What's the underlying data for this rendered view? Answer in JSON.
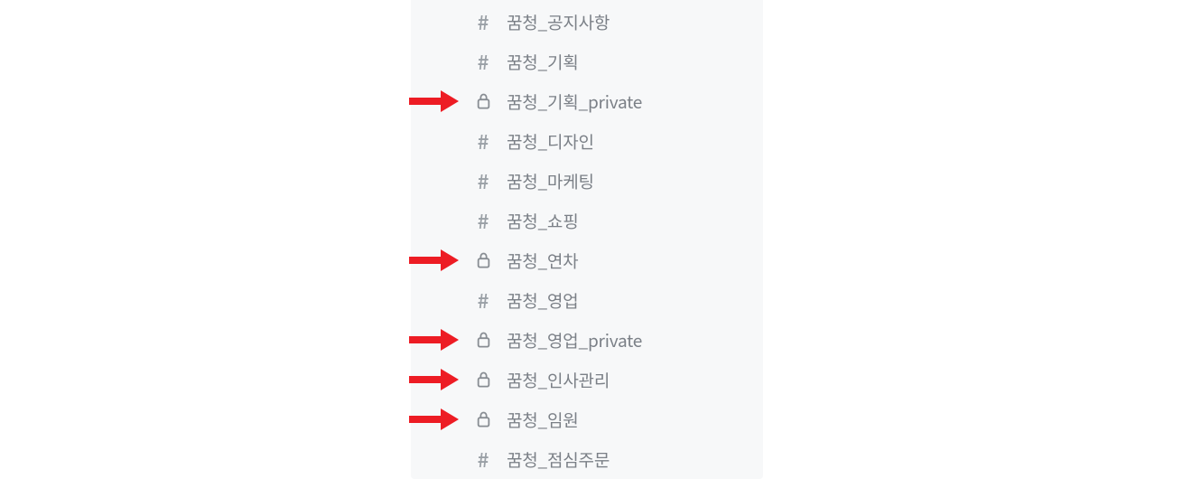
{
  "channels": [
    {
      "name": "꿈청_공지사항",
      "private": false,
      "highlighted": false
    },
    {
      "name": "꿈청_기획",
      "private": false,
      "highlighted": false
    },
    {
      "name": "꿈청_기획_private",
      "private": true,
      "highlighted": true
    },
    {
      "name": "꿈청_디자인",
      "private": false,
      "highlighted": false
    },
    {
      "name": "꿈청_마케팅",
      "private": false,
      "highlighted": false
    },
    {
      "name": "꿈청_쇼핑",
      "private": false,
      "highlighted": false
    },
    {
      "name": "꿈청_연차",
      "private": true,
      "highlighted": true
    },
    {
      "name": "꿈청_영업",
      "private": false,
      "highlighted": false
    },
    {
      "name": "꿈청_영업_private",
      "private": true,
      "highlighted": true
    },
    {
      "name": "꿈청_인사관리",
      "private": true,
      "highlighted": true
    },
    {
      "name": "꿈청_임원",
      "private": true,
      "highlighted": true
    },
    {
      "name": "꿈청_점심주문",
      "private": false,
      "highlighted": false
    }
  ],
  "icons": {
    "hash_glyph": "#"
  },
  "colors": {
    "arrow": "#ed1c24",
    "panel_bg": "#f7f8f9",
    "text": "#7b8087"
  }
}
